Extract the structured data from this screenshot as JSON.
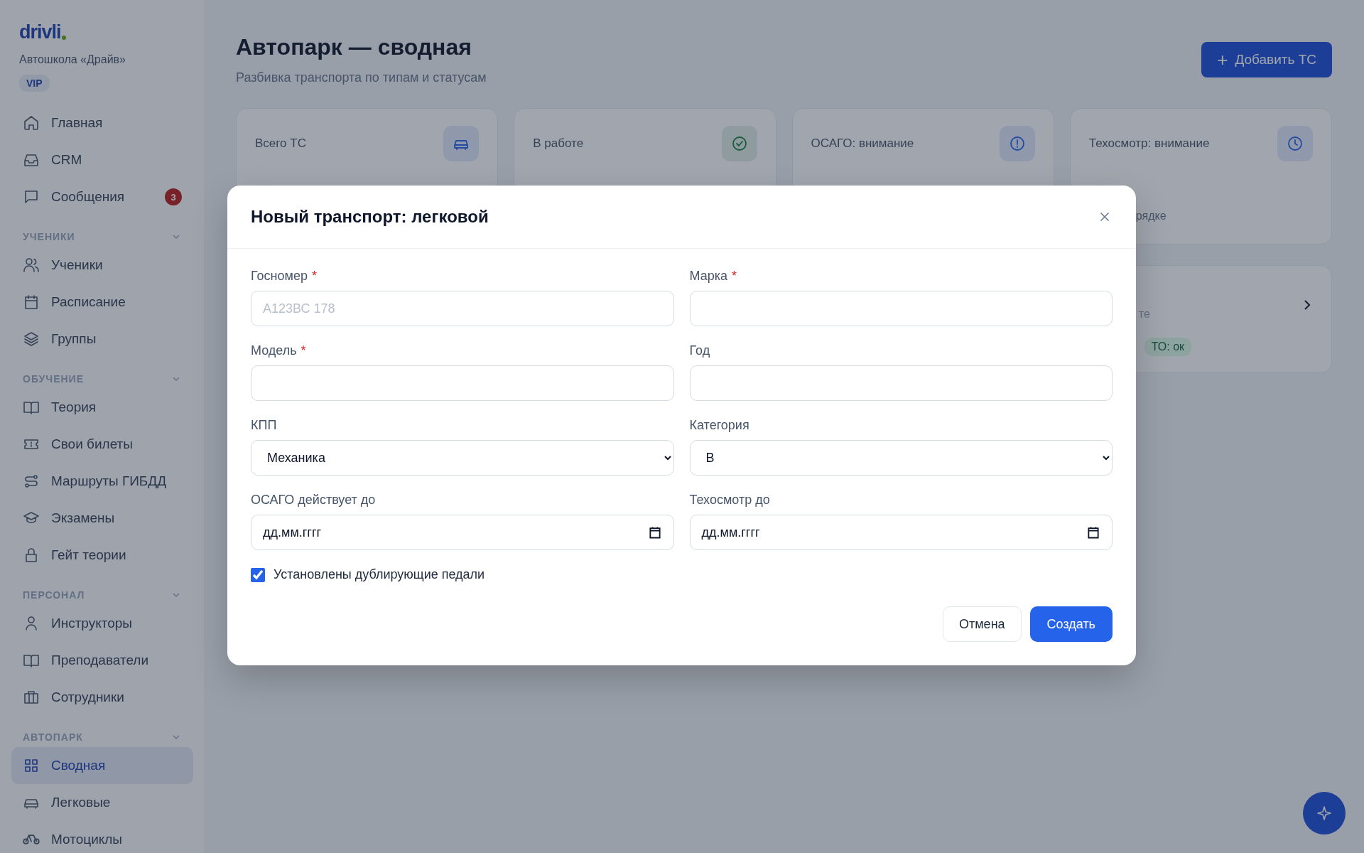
{
  "sidebar": {
    "logo": "drivli",
    "org": "Автошкола «Драйв»",
    "plan": "VIP",
    "sections": [
      {
        "items": [
          {
            "label": "Главная",
            "selected": false
          },
          {
            "label": "CRM",
            "selected": false
          },
          {
            "label": "Сообщения",
            "selected": false,
            "badge": "3"
          }
        ]
      },
      {
        "title": "УЧЕНИКИ",
        "expanded": true,
        "items": [
          {
            "label": "Ученики",
            "selected": false
          },
          {
            "label": "Расписание",
            "selected": false
          },
          {
            "label": "Группы",
            "selected": false
          }
        ]
      },
      {
        "title": "ОБУЧЕНИЕ",
        "expanded": true,
        "items": [
          {
            "label": "Теория",
            "selected": false
          },
          {
            "label": "Свои билеты",
            "selected": false
          },
          {
            "label": "Маршруты ГИБДД",
            "selected": false
          },
          {
            "label": "Экзамены",
            "selected": false
          },
          {
            "label": "Гейт теории",
            "selected": false
          }
        ]
      },
      {
        "title": "ПЕРСОНАЛ",
        "expanded": true,
        "items": [
          {
            "label": "Инструкторы",
            "selected": false
          },
          {
            "label": "Преподаватели",
            "selected": false
          },
          {
            "label": "Сотрудники",
            "selected": false
          }
        ]
      },
      {
        "title": "АВТОПАРК",
        "expanded": true,
        "items": [
          {
            "label": "Сводная",
            "selected": true
          },
          {
            "label": "Легковые",
            "selected": false
          },
          {
            "label": "Мотоциклы",
            "selected": false
          }
        ]
      }
    ]
  },
  "page": {
    "title": "Автопарк — сводная",
    "subtitle": "Разбивка транспорта по типам и статусам",
    "add_button": {
      "icon": "+",
      "label": "Добавить ТС"
    }
  },
  "stats": [
    {
      "label": "Всего ТС"
    },
    {
      "label": "В работе"
    },
    {
      "label": "ОСАГО: внимание"
    },
    {
      "label": "Техосмотр: внимание",
      "note": "рядке"
    }
  ],
  "type_card": {
    "text": "те",
    "tag": "ТО: ок"
  },
  "modal": {
    "title": "Новый транспорт: легковой",
    "fields": [
      {
        "kind": "text",
        "label": "Госномер",
        "required_mark": "*",
        "placeholder": "А123ВС 178"
      },
      {
        "kind": "text",
        "label": "Марка",
        "required_mark": "*"
      },
      {
        "kind": "text",
        "label": "Модель",
        "required_mark": "*"
      },
      {
        "kind": "text",
        "label": "Год"
      },
      {
        "kind": "select",
        "label": "КПП",
        "value": "Механика"
      },
      {
        "kind": "select",
        "label": "Категория",
        "value": "B"
      },
      {
        "kind": "date",
        "label": "ОСАГО действует до",
        "value": "дд.мм.гггг"
      },
      {
        "kind": "date",
        "label": "Техосмотр до",
        "value": "дд.мм.гггг"
      }
    ],
    "checkbox": {
      "label": "Установлены дублирующие педали",
      "checked": true
    },
    "buttons": [
      {
        "kind": "secondary",
        "label": "Отмена"
      },
      {
        "kind": "primary",
        "label": "Создать"
      }
    ]
  }
}
